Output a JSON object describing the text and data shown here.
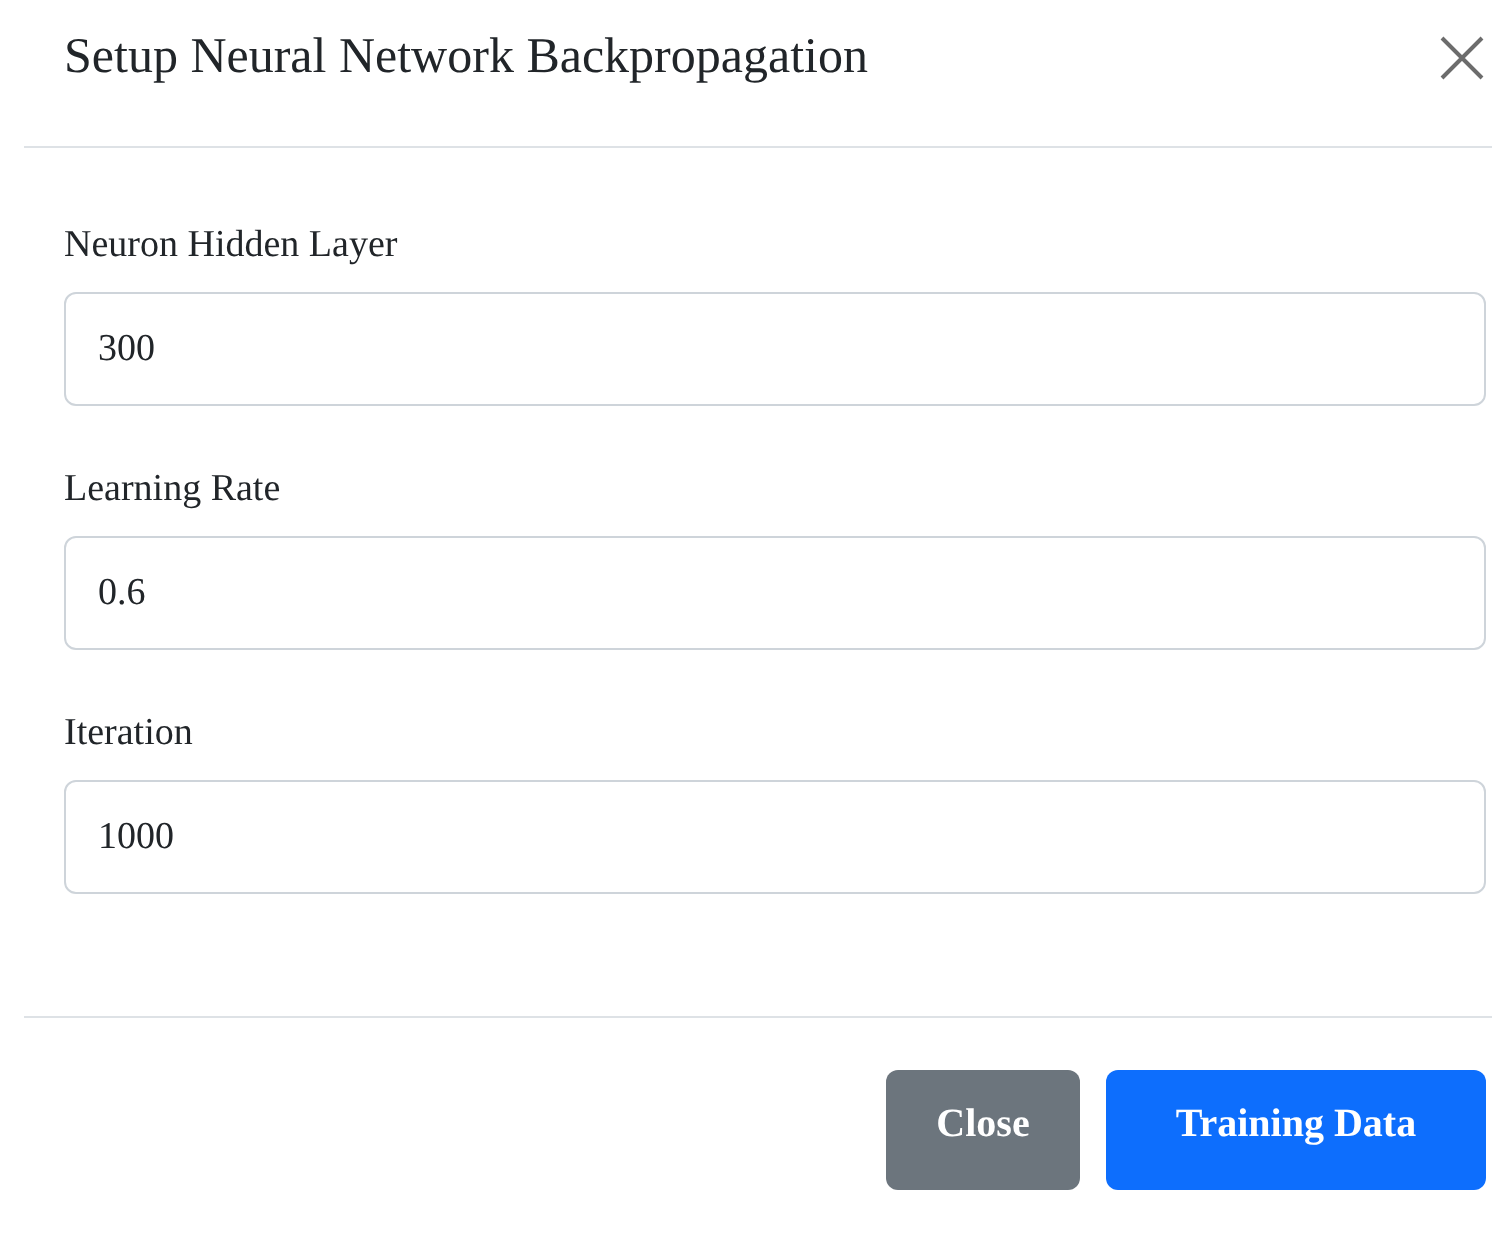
{
  "dialog": {
    "title": "Setup Neural Network Backpropagation"
  },
  "fields": [
    {
      "label": "Neuron Hidden Layer",
      "value": "300"
    },
    {
      "label": "Learning Rate",
      "value": "0.6"
    },
    {
      "label": "Iteration",
      "value": "1000"
    }
  ],
  "buttons": [
    {
      "label": "Close",
      "kind": "secondary"
    },
    {
      "label": "Training Data",
      "kind": "primary"
    }
  ]
}
